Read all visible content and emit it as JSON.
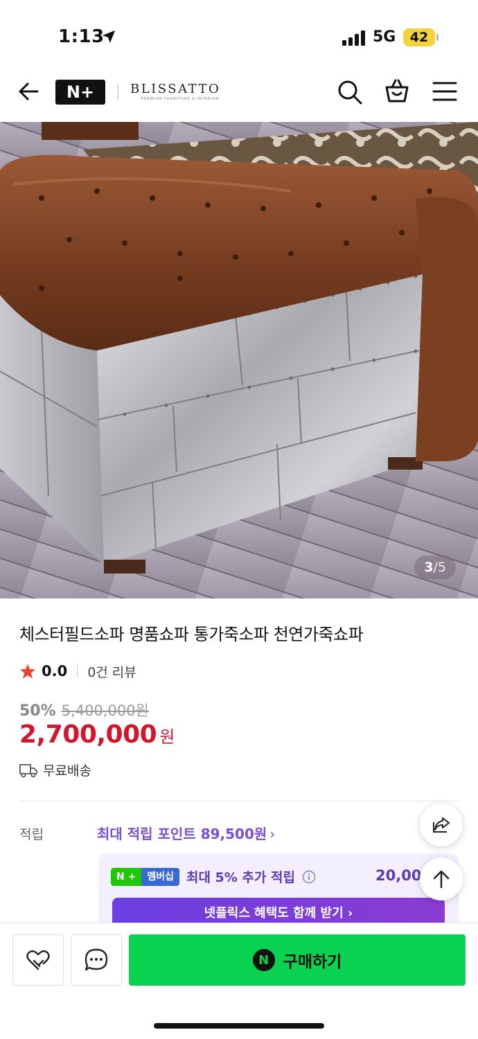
{
  "status": {
    "time": "1:13",
    "network": "5G",
    "battery": "42"
  },
  "nav": {
    "logo": "N+",
    "brand": "BLISSATTO",
    "brand_sub": "PREMIUM FURNITURE & INTERIOR"
  },
  "hero": {
    "counter_current": "3",
    "counter_sep": "/",
    "counter_total": "5"
  },
  "product": {
    "title": "체스터필드소파 명품쇼파 통가죽소파 천연가죽쇼파",
    "rating": "0.0",
    "review_count": "0건 리뷰",
    "discount_rate": "50%",
    "original_price": "5,400,000원",
    "price": "2,700,000",
    "price_unit": "원",
    "shipping": "무료배송"
  },
  "points": {
    "label": "적립",
    "link": "최대 적립 포인트 89,500원",
    "chevron": "›"
  },
  "membership": {
    "badge_left": "N",
    "badge_plus": "+",
    "badge_right": "멤버십",
    "text": "최대 5% 추가 적립",
    "amount": "20,00",
    "netflix": "넷플릭스 혜택도 함께 받기 ›"
  },
  "bottom": {
    "buy_label": "구매하기",
    "buy_icon_letter": "N"
  },
  "colors": {
    "price_red": "#d2172c",
    "accent_purple": "#7a4dd6",
    "buy_green": "#08d24f"
  }
}
